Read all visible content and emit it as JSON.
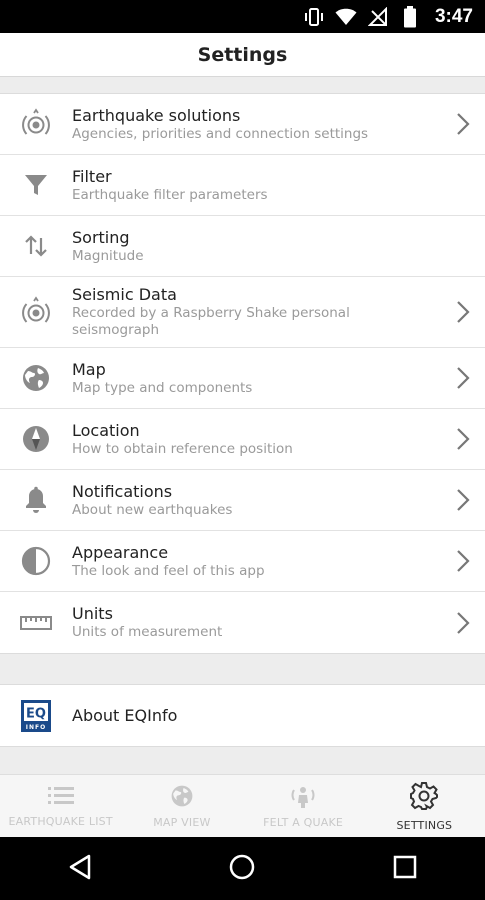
{
  "status_bar": {
    "time": "3:47",
    "icons": [
      "vibrate-icon",
      "wifi-icon",
      "no-signal-icon",
      "battery-icon"
    ]
  },
  "header": {
    "title": "Settings"
  },
  "settings": [
    {
      "icon": "radio-waves-icon",
      "title": "Earthquake solutions",
      "subtitle": "Agencies, priorities and connection settings",
      "chevron": true
    },
    {
      "icon": "filter-icon",
      "title": "Filter",
      "subtitle": "Earthquake filter parameters",
      "chevron": false
    },
    {
      "icon": "sort-icon",
      "title": "Sorting",
      "subtitle": "Magnitude",
      "chevron": false
    },
    {
      "icon": "radio-waves-icon",
      "title": "Seismic Data",
      "subtitle": "Recorded by a Raspberry Shake personal seismograph",
      "chevron": true
    },
    {
      "icon": "globe-icon",
      "title": "Map",
      "subtitle": "Map type and components",
      "chevron": true
    },
    {
      "icon": "compass-icon",
      "title": "Location",
      "subtitle": "How to obtain reference position",
      "chevron": true
    },
    {
      "icon": "bell-icon",
      "title": "Notifications",
      "subtitle": "About new earthquakes",
      "chevron": true
    },
    {
      "icon": "contrast-icon",
      "title": "Appearance",
      "subtitle": "The look and feel of this app",
      "chevron": true
    },
    {
      "icon": "ruler-icon",
      "title": "Units",
      "subtitle": "Units of measurement",
      "chevron": true
    }
  ],
  "about": {
    "title": "About EQInfo",
    "logo_text": "EQ",
    "logo_subtext": "INFO"
  },
  "bottom_nav": [
    {
      "icon": "list-icon",
      "label": "EARTHQUAKE LIST",
      "active": false
    },
    {
      "icon": "globe-icon",
      "label": "MAP VIEW",
      "active": false
    },
    {
      "icon": "felt-quake-icon",
      "label": "FELT A QUAKE",
      "active": false
    },
    {
      "icon": "gear-icon",
      "label": "SETTINGS",
      "active": true
    }
  ],
  "colors": {
    "icon_gray": "#8a8a8a",
    "inactive_tab": "#c8c8c8",
    "active_tab": "#333333",
    "logo_blue": "#1a4a8a"
  }
}
